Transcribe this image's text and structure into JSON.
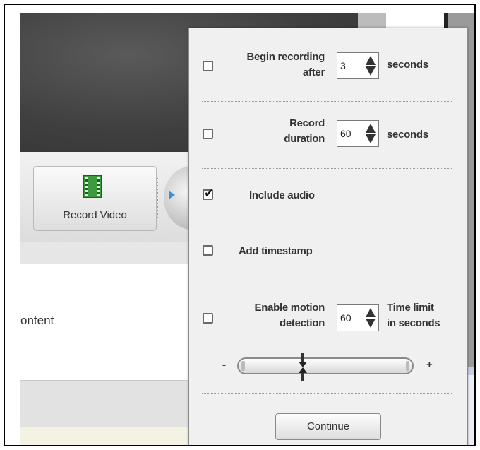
{
  "app": {
    "record_video_label": "Record Video",
    "content_fragment": "ontent"
  },
  "panel": {
    "begin_recording": {
      "checked": false,
      "label_line1": "Begin recording",
      "label_line2": "after",
      "value": "3",
      "unit": "seconds"
    },
    "record_duration": {
      "checked": false,
      "label_line1": "Record",
      "label_line2": "duration",
      "value": "60",
      "unit": "seconds"
    },
    "include_audio": {
      "checked": true,
      "label": "Include audio"
    },
    "add_timestamp": {
      "checked": false,
      "label": "Add timestamp"
    },
    "motion_detection": {
      "checked": false,
      "label_line1": "Enable motion",
      "label_line2": "detection",
      "value": "60",
      "unit_line1": "Time limit",
      "unit_line2": "in seconds",
      "sensitivity_fraction": 0.37
    },
    "slider_minus": "-",
    "slider_plus": "+",
    "continue_label": "Continue"
  },
  "icons": {
    "record": "film-icon",
    "play": "play-icon",
    "up": "up-arrow-icon",
    "down": "down-arrow-icon"
  }
}
